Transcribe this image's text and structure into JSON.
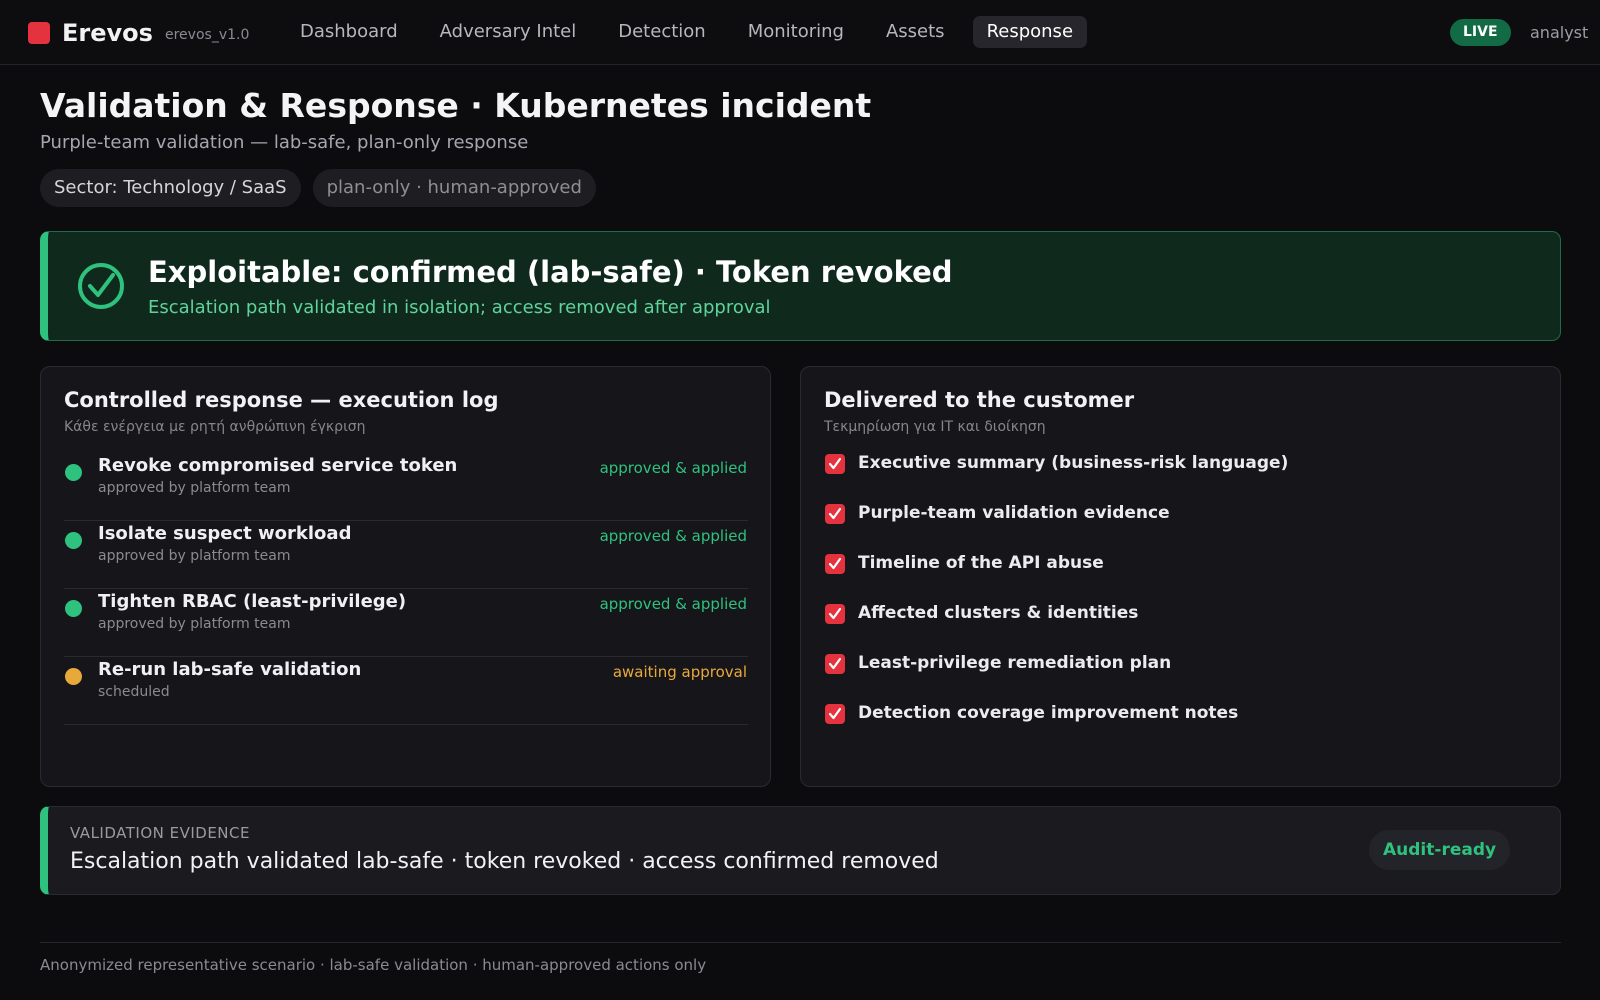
{
  "app": {
    "brand_name": "Erevos",
    "version": "erevos_v1.0",
    "live_label": "LIVE",
    "user_label": "analyst",
    "brand_color": "#e5323f"
  },
  "nav": {
    "items": [
      {
        "label": "Dashboard",
        "active": false
      },
      {
        "label": "Adversary Intel",
        "active": false
      },
      {
        "label": "Detection",
        "active": false
      },
      {
        "label": "Monitoring",
        "active": false
      },
      {
        "label": "Assets",
        "active": false
      },
      {
        "label": "Response",
        "active": true
      }
    ]
  },
  "header": {
    "title": "Validation & Response · Kubernetes incident",
    "subtitle": "Purple-team validation — lab-safe, plan-only response",
    "tags": [
      "Sector: Technology / SaaS",
      "plan-only · human-approved"
    ]
  },
  "alert": {
    "icon": "check-circle-icon",
    "title": "Exploitable: confirmed (lab-safe) · Token revoked",
    "subtitle": "Escalation path validated in isolation; access removed after approval",
    "color": "#2ec27e"
  },
  "execution_log": {
    "title": "Controlled response — execution log",
    "subtitle": "Κάθε ενέργεια με ρητή ανθρώπινη έγκριση",
    "items": [
      {
        "title": "Revoke compromised service token",
        "meta": "approved by platform team",
        "status": "approved & applied",
        "color": "#2ec27e"
      },
      {
        "title": "Isolate suspect workload",
        "meta": "approved by platform team",
        "status": "approved & applied",
        "color": "#2ec27e"
      },
      {
        "title": "Tighten RBAC (least-privilege)",
        "meta": "approved by platform team",
        "status": "approved & applied",
        "color": "#2ec27e"
      },
      {
        "title": "Re-run lab-safe validation",
        "meta": "scheduled",
        "status": "awaiting approval",
        "color": "#e8a93b"
      }
    ]
  },
  "deliverables": {
    "title": "Delivered to the customer",
    "subtitle": "Τεκμηρίωση για IT και διοίκηση",
    "items": [
      "Executive summary (business-risk language)",
      "Purple-team validation evidence",
      "Timeline of the API abuse",
      "Affected clusters & identities",
      "Least-privilege remediation plan",
      "Detection coverage improvement notes"
    ]
  },
  "evidence": {
    "label": "VALIDATION EVIDENCE",
    "text": "Escalation path validated lab-safe · token revoked · access confirmed removed",
    "badge": "Audit-ready"
  },
  "footer": {
    "text": "Anonymized representative scenario · lab-safe validation · human-approved actions only"
  }
}
